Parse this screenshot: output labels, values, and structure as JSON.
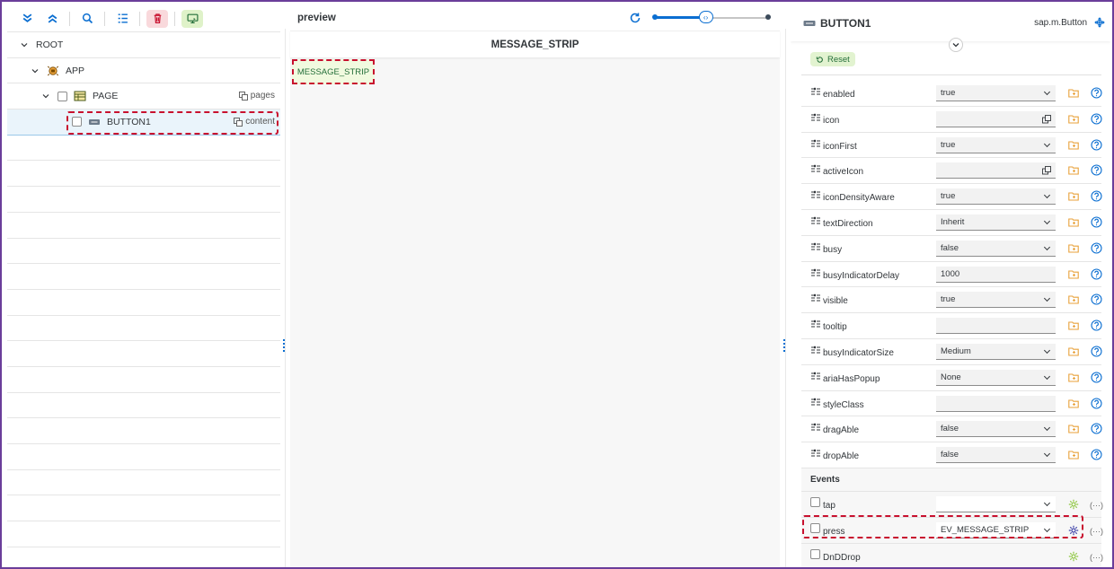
{
  "toolbar": {
    "buttons": [
      {
        "name": "expand-all",
        "icon": "chevrons-down-icon"
      },
      {
        "name": "collapse-all",
        "icon": "chevrons-up-icon"
      },
      {
        "name": "search",
        "icon": "search-icon"
      },
      {
        "name": "tree-list",
        "icon": "list-tree-icon"
      },
      {
        "name": "delete",
        "icon": "trash-icon"
      },
      {
        "name": "preview-toggle",
        "icon": "screen-icon"
      }
    ]
  },
  "tree": {
    "root": {
      "label": "ROOT"
    },
    "app": {
      "label": "APP"
    },
    "page": {
      "label": "PAGE",
      "aggregation": "pages"
    },
    "button1": {
      "label": "BUTTON1",
      "aggregation": "content"
    }
  },
  "preview": {
    "title": "preview",
    "page_title": "MESSAGE_STRIP",
    "message_strip_label": "MESSAGE_STRIP",
    "zoom_fraction": 0.45
  },
  "inspector": {
    "control_name": "BUTTON1",
    "control_class": "sap.m.Button",
    "reset_label": "Reset",
    "properties": [
      {
        "name": "enabled",
        "value": "true",
        "kind": "dropdown"
      },
      {
        "name": "icon",
        "value": "",
        "kind": "valuehelp"
      },
      {
        "name": "iconFirst",
        "value": "true",
        "kind": "dropdown"
      },
      {
        "name": "activeIcon",
        "value": "",
        "kind": "valuehelp"
      },
      {
        "name": "iconDensityAware",
        "value": "true",
        "kind": "dropdown"
      },
      {
        "name": "textDirection",
        "value": "Inherit",
        "kind": "dropdown"
      },
      {
        "name": "busy",
        "value": "false",
        "kind": "dropdown"
      },
      {
        "name": "busyIndicatorDelay",
        "value": "1000",
        "kind": "input"
      },
      {
        "name": "visible",
        "value": "true",
        "kind": "dropdown"
      },
      {
        "name": "tooltip",
        "value": "",
        "kind": "input"
      },
      {
        "name": "busyIndicatorSize",
        "value": "Medium",
        "kind": "dropdown"
      },
      {
        "name": "ariaHasPopup",
        "value": "None",
        "kind": "dropdown"
      },
      {
        "name": "styleClass",
        "value": "",
        "kind": "input"
      },
      {
        "name": "dragAble",
        "value": "false",
        "kind": "dropdown"
      },
      {
        "name": "dropAble",
        "value": "false",
        "kind": "dropdown"
      }
    ],
    "events_title": "Events",
    "events": [
      {
        "name": "tap",
        "value": "",
        "kind": "dropdown",
        "gear_color": "#8dc63f"
      },
      {
        "name": "press",
        "value": "EV_MESSAGE_STRIP",
        "kind": "dropdown",
        "gear_color": "#3b3fa8",
        "highlight": true
      },
      {
        "name": "DnDDrop",
        "value": "",
        "kind": "none",
        "gear_color": "#8dc63f"
      }
    ]
  },
  "colors": {
    "frame": "#6a3d9a",
    "accent": "#0a6ed1",
    "highlight_dash": "#c8102e",
    "folder": "#e9a23b",
    "help": "#0a6ed1"
  }
}
